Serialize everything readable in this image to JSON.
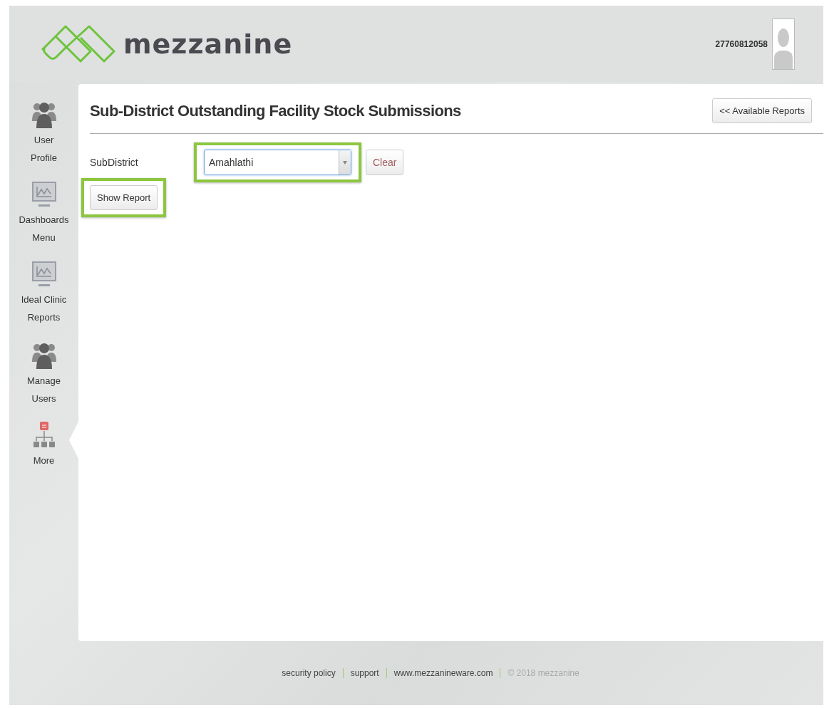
{
  "header": {
    "brand": "mezzanine",
    "user_id": "27760812058"
  },
  "sidebar": {
    "items": [
      {
        "label_lines": [
          "User",
          "Profile"
        ],
        "kind": "people",
        "selected": false
      },
      {
        "label_lines": [
          "Dashboards",
          "Menu"
        ],
        "kind": "monitor",
        "selected": false
      },
      {
        "label_lines": [
          "Ideal Clinic",
          "Reports"
        ],
        "kind": "monitor",
        "selected": false
      },
      {
        "label_lines": [
          "Manage",
          "Users"
        ],
        "kind": "people",
        "selected": false
      },
      {
        "label_lines": [
          "More"
        ],
        "kind": "hierarchy",
        "selected": true
      }
    ]
  },
  "page": {
    "title": "Sub-District Outstanding Facility Stock Submissions",
    "back_button": "<< Available Reports",
    "form": {
      "label": "SubDistrict",
      "select_value": "Amahlathi",
      "select_highlighted": true,
      "clear_button": "Clear",
      "submit_button": "Show Report",
      "submit_highlighted": true
    }
  },
  "footer": {
    "links": [
      "security policy",
      "support",
      "www.mezzanineware.com"
    ],
    "copyright": "© 2018 mezzanine"
  }
}
